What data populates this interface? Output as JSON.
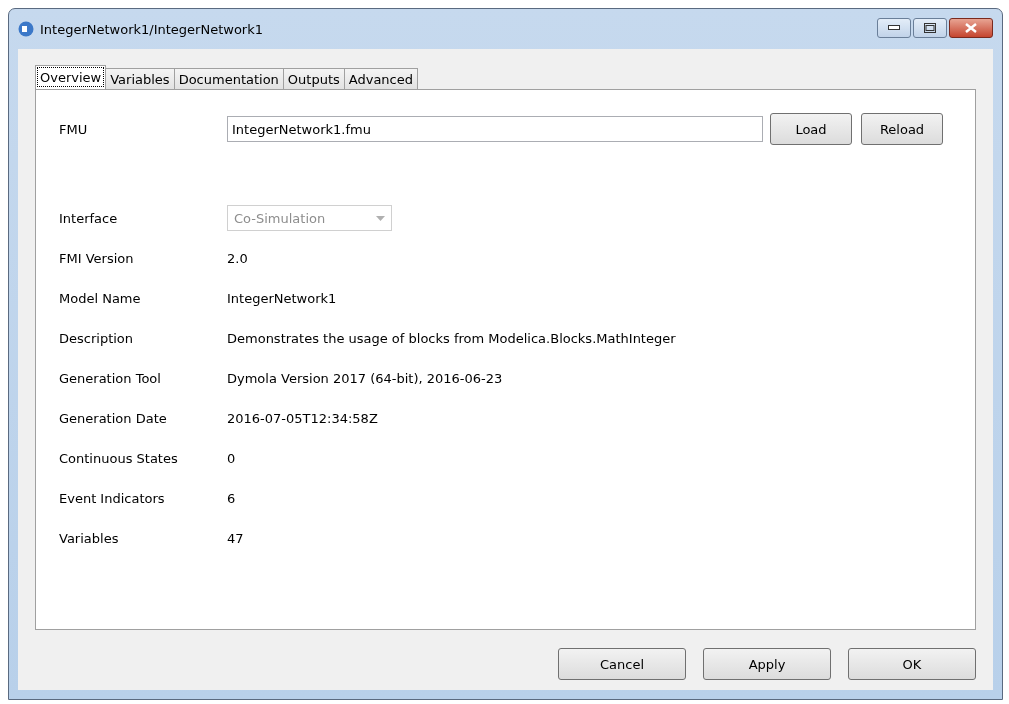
{
  "window": {
    "title": "IntegerNetwork1/IntegerNetwork1"
  },
  "tabs": [
    {
      "label": "Overview",
      "selected": true
    },
    {
      "label": "Variables",
      "selected": false
    },
    {
      "label": "Documentation",
      "selected": false
    },
    {
      "label": "Outputs",
      "selected": false
    },
    {
      "label": "Advanced",
      "selected": false
    }
  ],
  "fmu": {
    "label": "FMU",
    "value": "IntegerNetwork1.fmu",
    "buttons": [
      "Load",
      "Reload"
    ]
  },
  "fields": [
    {
      "kind": "combo",
      "label": "Interface",
      "value": "Co-Simulation",
      "disabled": true
    },
    {
      "kind": "text",
      "label": "FMI Version",
      "value": "2.0"
    },
    {
      "kind": "text",
      "label": "Model Name",
      "value": "IntegerNetwork1"
    },
    {
      "kind": "text",
      "label": "Description",
      "value": "Demonstrates the usage of blocks from Modelica.Blocks.MathInteger"
    },
    {
      "kind": "text",
      "label": "Generation Tool",
      "value": "Dymola Version 2017 (64-bit), 2016-06-23"
    },
    {
      "kind": "text",
      "label": "Generation Date",
      "value": "2016-07-05T12:34:58Z"
    },
    {
      "kind": "text",
      "label": "Continuous States",
      "value": "0"
    },
    {
      "kind": "text",
      "label": "Event Indicators",
      "value": "6"
    },
    {
      "kind": "text",
      "label": "Variables",
      "value": "47"
    }
  ],
  "buttons": [
    "Cancel",
    "Apply",
    "OK"
  ]
}
